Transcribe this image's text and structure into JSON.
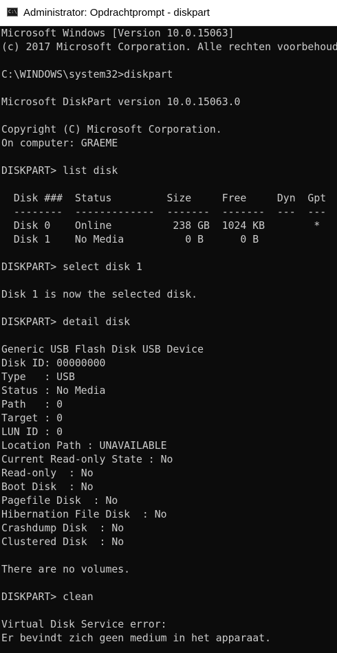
{
  "window": {
    "title": "Administrator: Opdrachtprompt - diskpart",
    "icon": "cmd-icon"
  },
  "colors": {
    "console_background": "#0c0c0c",
    "console_text": "#cccccc",
    "titlebar_background": "#ffffff"
  },
  "console": {
    "lines": [
      "Microsoft Windows [Version 10.0.15063]",
      "(c) 2017 Microsoft Corporation. Alle rechten voorbehoud",
      "",
      "C:\\WINDOWS\\system32>diskpart",
      "",
      "Microsoft DiskPart version 10.0.15063.0",
      "",
      "Copyright (C) Microsoft Corporation.",
      "On computer: GRAEME",
      "",
      "DISKPART> list disk",
      "",
      "  Disk ###  Status         Size     Free     Dyn  Gpt",
      "  --------  -------------  -------  -------  ---  ---",
      "  Disk 0    Online          238 GB  1024 KB        *",
      "  Disk 1    No Media          0 B      0 B",
      "",
      "DISKPART> select disk 1",
      "",
      "Disk 1 is now the selected disk.",
      "",
      "DISKPART> detail disk",
      "",
      "Generic USB Flash Disk USB Device",
      "Disk ID: 00000000",
      "Type   : USB",
      "Status : No Media",
      "Path   : 0",
      "Target : 0",
      "LUN ID : 0",
      "Location Path : UNAVAILABLE",
      "Current Read-only State : No",
      "Read-only  : No",
      "Boot Disk  : No",
      "Pagefile Disk  : No",
      "Hibernation File Disk  : No",
      "Crashdump Disk  : No",
      "Clustered Disk  : No",
      "",
      "There are no volumes.",
      "",
      "DISKPART> clean",
      "",
      "Virtual Disk Service error:",
      "Er bevindt zich geen medium in het apparaat."
    ]
  }
}
